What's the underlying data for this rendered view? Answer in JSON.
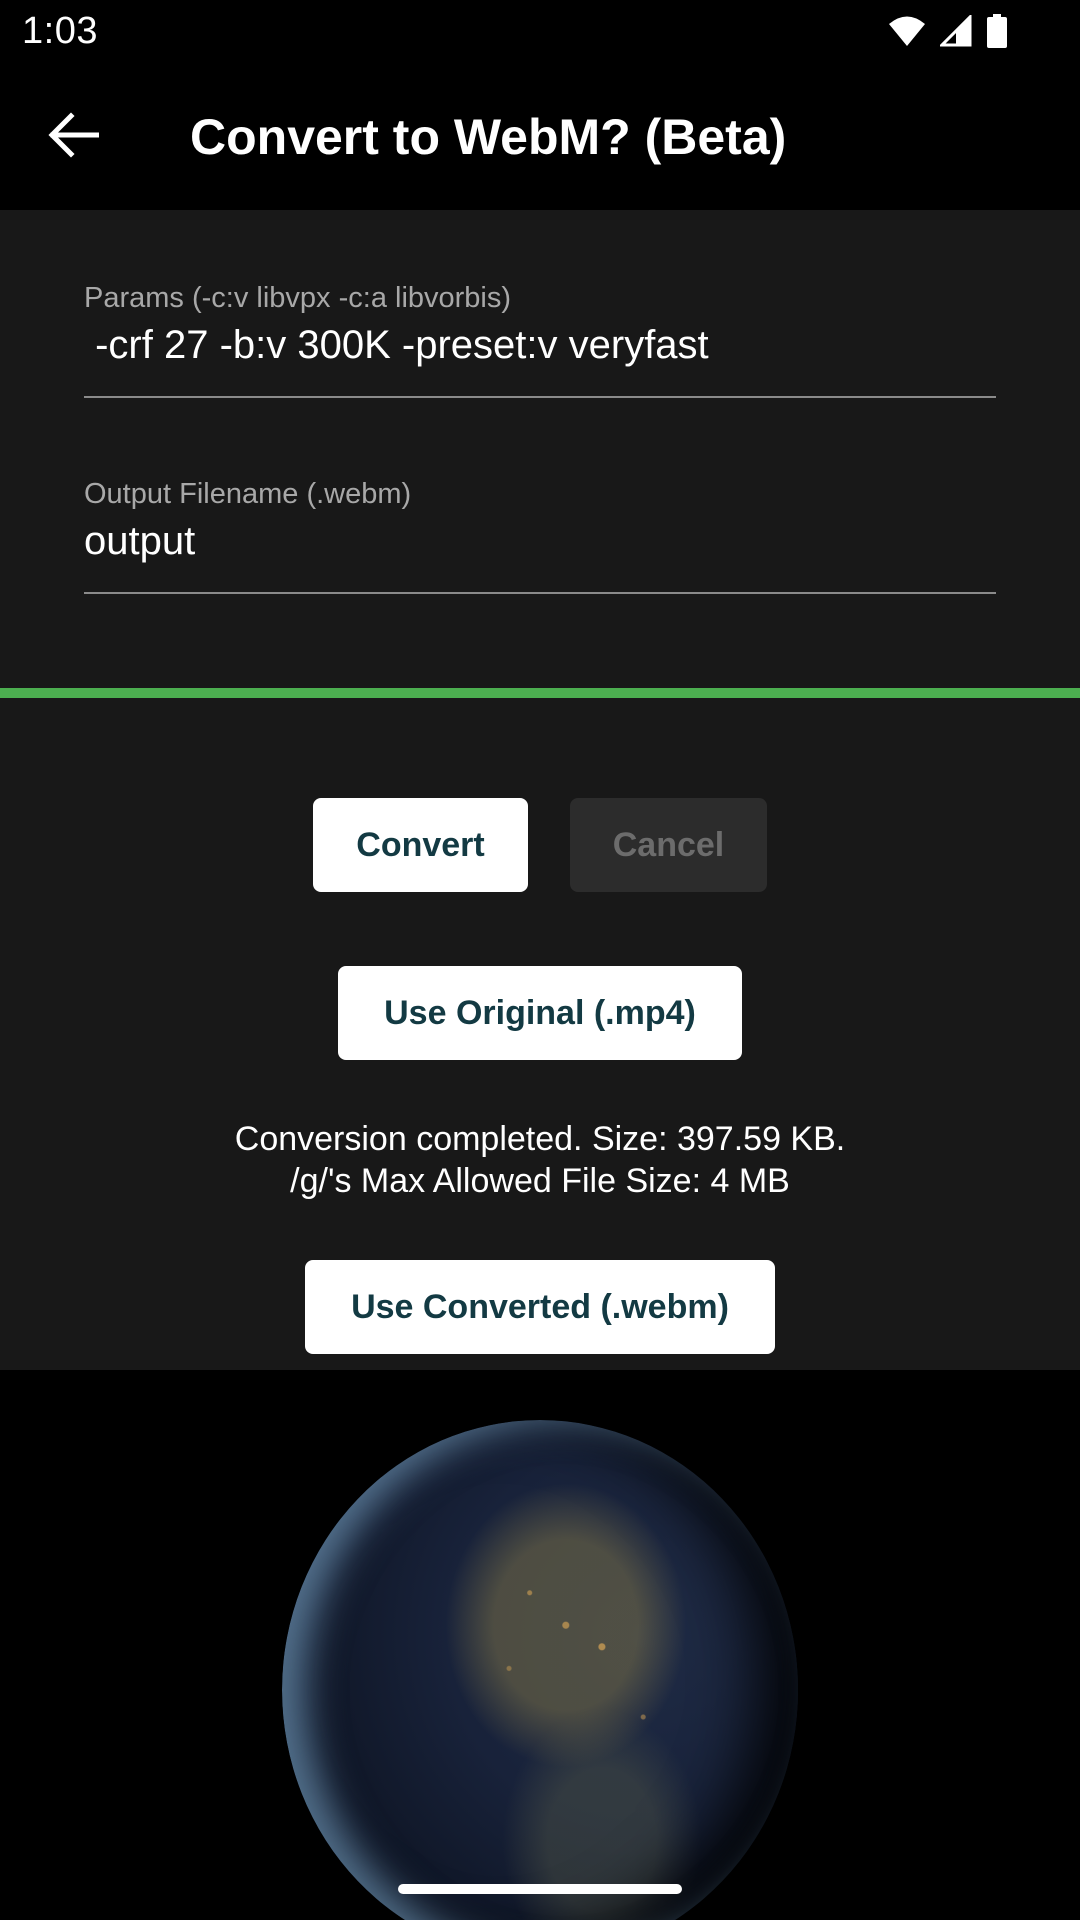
{
  "status_bar": {
    "time": "1:03",
    "icons": [
      "wifi-icon",
      "cell-signal-icon",
      "battery-icon"
    ]
  },
  "app_bar": {
    "title": "Convert to WebM? (Beta)",
    "back_icon": "arrow-back-icon"
  },
  "form": {
    "params": {
      "label": "Params (-c:v libvpx -c:a libvorbis)",
      "value": " -crf 27 -b:v 300K -preset:v veryfast"
    },
    "output": {
      "label": "Output Filename (.webm)",
      "value": "output"
    }
  },
  "progress": {
    "value_percent": 100,
    "color": "#4caf50"
  },
  "buttons": {
    "convert": "Convert",
    "cancel": "Cancel",
    "use_original": "Use Original (.mp4)",
    "use_converted": "Use Converted (.webm)"
  },
  "result": {
    "line1": "Conversion completed. Size: 397.59 KB.",
    "line2": "/g/'s Max Allowed File Size: 4 MB"
  },
  "colors": {
    "background": "#181818",
    "accent": "#4caf50",
    "button_text": "#133a43"
  }
}
